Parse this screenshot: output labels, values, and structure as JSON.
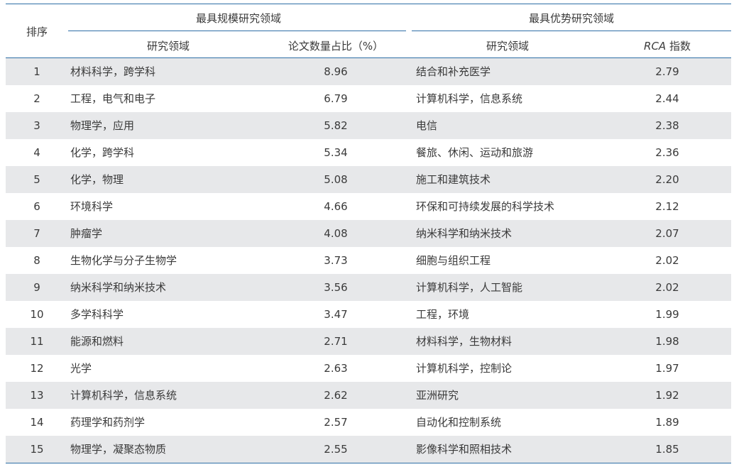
{
  "header": {
    "rank_label": "排序",
    "group_left": "最具规模研究领域",
    "group_right": "最具优势研究领域",
    "col_field_left": "研究领域",
    "col_ratio": "论文数量占比（%）",
    "col_field_right": "研究领域",
    "col_rca_italic": "RCA",
    "col_rca_suffix": " 指数"
  },
  "rows": [
    {
      "rank": "1",
      "field1": "材料科学，跨学科",
      "ratio": "8.96",
      "field2": "结合和补充医学",
      "rca": "2.79"
    },
    {
      "rank": "2",
      "field1": "工程，电气和电子",
      "ratio": "6.79",
      "field2": "计算机科学，信息系统",
      "rca": "2.44"
    },
    {
      "rank": "3",
      "field1": "物理学，应用",
      "ratio": "5.82",
      "field2": "电信",
      "rca": "2.38"
    },
    {
      "rank": "4",
      "field1": "化学，跨学科",
      "ratio": "5.34",
      "field2": "餐旅、休闲、运动和旅游",
      "rca": "2.36"
    },
    {
      "rank": "5",
      "field1": "化学，物理",
      "ratio": "5.08",
      "field2": "施工和建筑技术",
      "rca": "2.20"
    },
    {
      "rank": "6",
      "field1": "环境科学",
      "ratio": "4.66",
      "field2": "环保和可持续发展的科学技术",
      "rca": "2.12"
    },
    {
      "rank": "7",
      "field1": "肿瘤学",
      "ratio": "4.08",
      "field2": "纳米科学和纳米技术",
      "rca": "2.07"
    },
    {
      "rank": "8",
      "field1": "生物化学与分子生物学",
      "ratio": "3.73",
      "field2": "细胞与组织工程",
      "rca": "2.02"
    },
    {
      "rank": "9",
      "field1": "纳米科学和纳米技术",
      "ratio": "3.56",
      "field2": "计算机科学，人工智能",
      "rca": "2.02"
    },
    {
      "rank": "10",
      "field1": "多学科科学",
      "ratio": "3.47",
      "field2": "工程，环境",
      "rca": "1.99"
    },
    {
      "rank": "11",
      "field1": "能源和燃料",
      "ratio": "2.71",
      "field2": "材料科学，生物材料",
      "rca": "1.98"
    },
    {
      "rank": "12",
      "field1": "光学",
      "ratio": "2.63",
      "field2": "计算机科学，控制论",
      "rca": "1.97"
    },
    {
      "rank": "13",
      "field1": "计算机科学，信息系统",
      "ratio": "2.62",
      "field2": "亚洲研究",
      "rca": "1.92"
    },
    {
      "rank": "14",
      "field1": "药理学和药剂学",
      "ratio": "2.57",
      "field2": "自动化和控制系统",
      "rca": "1.89"
    },
    {
      "rank": "15",
      "field1": "物理学，凝聚态物质",
      "ratio": "2.55",
      "field2": "影像科学和照相技术",
      "rca": "1.85"
    }
  ]
}
